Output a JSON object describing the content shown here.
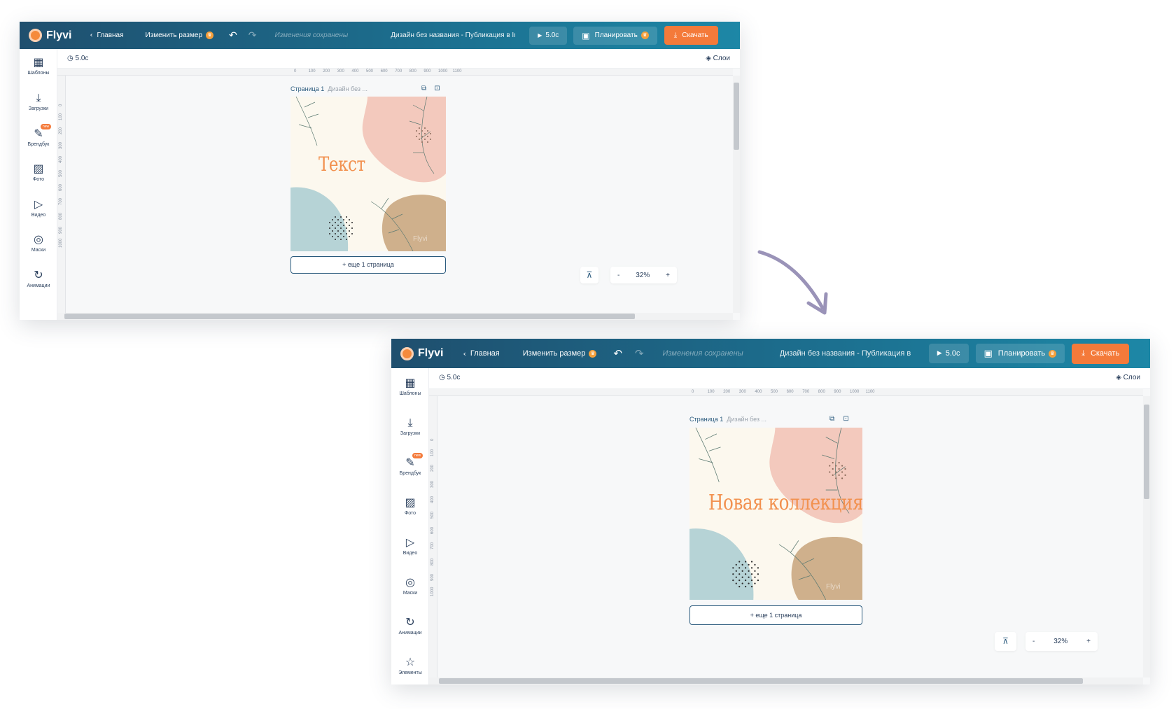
{
  "colors": {
    "topbar": "#1c6e8e",
    "accent_orange": "#f47a3a",
    "canvas_bg": "#fcf8ee",
    "canvas_text": "#f2914f",
    "arrow": "#9a93b8"
  },
  "editor": {
    "logo": "Flyvi",
    "home": "Главная",
    "resize": "Изменить размер",
    "saved": "Изменения сохранены",
    "doc_title": "Дизайн без названия - Публикация в In...",
    "play": "5.0с",
    "schedule": "Планировать",
    "download": "Скачать",
    "timer": "5.0с",
    "layers": "Слои",
    "page_label": "Страница 1",
    "page_sub": "Дизайн без ...",
    "add_page": "+ еще 1 страница",
    "zoom": "32%",
    "zoom_minus": "-",
    "zoom_plus": "+",
    "watermark": "Flyvi",
    "icons": {
      "back": "chevron-left-icon",
      "undo": "undo-icon",
      "redo": "redo-icon",
      "play": "play-icon",
      "calendar": "calendar-icon",
      "download": "download-icon",
      "timer": "clock-icon",
      "layers": "layers-icon",
      "copy": "duplicate-icon",
      "fit": "fit-to-screen-icon"
    }
  },
  "sidebar": {
    "templates": "Шаблоны",
    "uploads": "Загрузки",
    "brandbook": "Брендбук",
    "photo": "Фото",
    "video": "Видео",
    "masks": "Маски",
    "animations": "Анимации",
    "elements": "Элементы",
    "new_badge": "new"
  },
  "ruler": {
    "h_ticks": [
      "0",
      "100",
      "200",
      "300",
      "400",
      "500",
      "600",
      "700",
      "800",
      "900",
      "1000",
      "1100"
    ],
    "v_ticks": [
      "0",
      "100",
      "200",
      "300",
      "400",
      "500",
      "600",
      "700",
      "800",
      "900",
      "1000"
    ]
  },
  "before": {
    "canvas_text": "Текст"
  },
  "after": {
    "canvas_text": "Новая коллекция"
  }
}
